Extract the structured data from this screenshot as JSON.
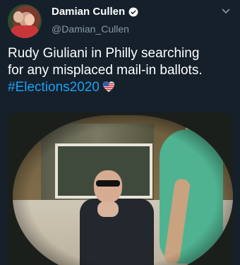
{
  "author": {
    "name": "Damian Cullen",
    "handle": "@Damian_Cullen",
    "verified": true
  },
  "tweet": {
    "line1": "Rudy Giuliani in Philly searching",
    "line2": "for any misplaced mail-in ballots.",
    "hashtag": "#Elections2020"
  },
  "icons": {
    "verified": "verified-badge-icon",
    "menu": "chevron-down-icon",
    "flag": "us-flag-heart-emoji"
  },
  "colors": {
    "background": "#15202b",
    "accent": "#1da1f2",
    "secondary_text": "#8899a6"
  }
}
